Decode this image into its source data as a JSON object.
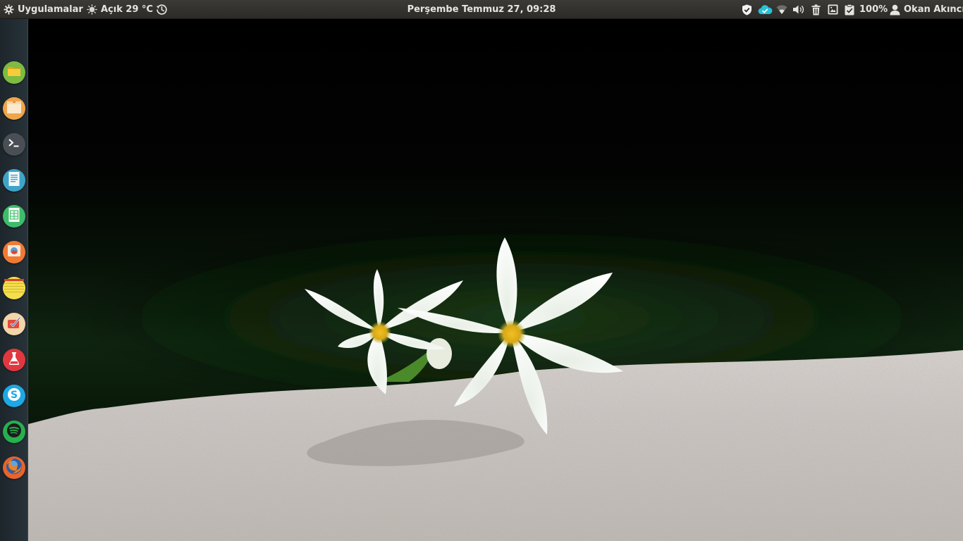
{
  "topbar": {
    "apps_label": "Uygulamalar",
    "weather_label": "Açık 29 °C",
    "clock": "Perşembe Temmuz 27, 09:28",
    "battery": "100%",
    "user": "Okan Akıncı",
    "indicators": [
      "shield-icon",
      "cloud-sync-icon",
      "wifi-icon",
      "volume-icon",
      "trash-icon",
      "screenshot-icon",
      "clipboard-icon",
      "battery-icon",
      "user-icon"
    ]
  },
  "dock": {
    "launchers": [
      {
        "name": "files",
        "icon": "folder-icon",
        "color": "#7dbb41"
      },
      {
        "name": "archive",
        "icon": "archive-icon",
        "color": "#f0a54a"
      },
      {
        "name": "terminal",
        "icon": "terminal-icon",
        "color": "#4a4f55"
      },
      {
        "name": "text-editor",
        "icon": "document-icon",
        "color": "#3fa3c8"
      },
      {
        "name": "spreadsheet",
        "icon": "spreadsheet-icon",
        "color": "#3ebc6a"
      },
      {
        "name": "image-viewer",
        "icon": "picture-icon",
        "color": "#f07a34"
      },
      {
        "name": "notes",
        "icon": "notepad-icon",
        "color": "#f4de4c"
      },
      {
        "name": "todo",
        "icon": "checkmark-icon",
        "color": "#f2d5a8"
      },
      {
        "name": "flask-app",
        "icon": "flask-icon",
        "color": "#e0383e"
      },
      {
        "name": "skype",
        "icon": "skype-icon",
        "color": "#1ea8e4"
      },
      {
        "name": "spotify",
        "icon": "spotify-icon",
        "color": "#27b04e"
      },
      {
        "name": "firefox",
        "icon": "firefox-icon",
        "color": "#e8632d"
      }
    ]
  },
  "colors": {
    "panel": "#2c2b28",
    "panel_text": "#e6e4df",
    "cloud_accent": "#2ac0d6"
  }
}
